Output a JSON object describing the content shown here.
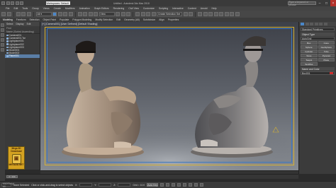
{
  "titlebar": {
    "workspace": "Workspaces: Default",
    "title": "Untitled - Autodesk 3ds Max 2018",
    "search": "Type a keyword or phrase"
  },
  "menubar": [
    "File",
    "Edit",
    "Tools",
    "Group",
    "Views",
    "Create",
    "Modifiers",
    "Animation",
    "Graph Editors",
    "Rendering",
    "Civil View",
    "Customize",
    "Scripting",
    "Interactive",
    "Content",
    "Arnold",
    "Help"
  ],
  "maintoolbar": {
    "view_dropdown": "View",
    "selection_set": "Create Selection Set"
  },
  "ribbon": {
    "tabs": [
      "Modeling",
      "Freeform",
      "Selection",
      "Object Paint",
      "Populate"
    ],
    "subtabs": [
      "Polygon Modeling",
      "Modify Selection",
      "Edit",
      "Geometry (All)",
      "Subdivision",
      "Align",
      "Properties"
    ]
  },
  "scene_explorer": {
    "tabs": [
      "Select",
      "Display",
      "Edit",
      "Customize"
    ],
    "search_placeholder": "Find",
    "sort_label": "Name (Sorted Ascending)",
    "items": [
      "Camera001",
      "Camera001.Tar",
      "Lightplane001",
      "Lightplane002",
      "Lightplane003",
      "Model001",
      "Model002",
      "Plane001"
    ]
  },
  "logo": {
    "line1": "Mega 3D Download",
    "line2": "MEGA3D.NET"
  },
  "viewport": {
    "label": "[+] [Camera001] [User Defined] [Default Shading]"
  },
  "command_panel": {
    "dropdown": "Standard Primitives",
    "section_object_type": "Object Type",
    "autogrid": "AutoGrid",
    "buttons": [
      "Box",
      "Cone",
      "Sphere",
      "GeoSphere",
      "Cylinder",
      "Tube",
      "Torus",
      "Pyramid",
      "Teapot",
      "Plane",
      "TextPlus"
    ],
    "section_name_color": "Name and Color",
    "name_value": "Box001"
  },
  "timeline": {
    "slider_label": "0 / 100"
  },
  "statusbar": {
    "maxscript": "MAXScript Mi",
    "status": "None Selected",
    "prompt": "Click or click-and-drag to select objects",
    "x_label": "X:",
    "y_label": "Y:",
    "z_label": "Z:",
    "grid": "Grid = 10.0",
    "autokey": "Auto Key",
    "selected": "Selected",
    "setkey": "Set Key",
    "keyfilters": "Key Filters..."
  }
}
